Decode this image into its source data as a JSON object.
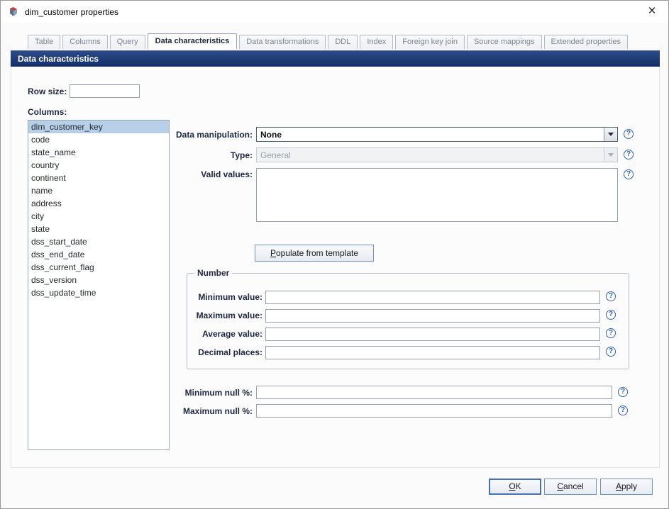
{
  "window": {
    "title": "dim_customer properties",
    "close_glyph": "×"
  },
  "tabs": {
    "items": [
      "Table",
      "Columns",
      "Query",
      "Data characteristics",
      "Data transformations",
      "DDL",
      "Index",
      "Foreign key join",
      "Source mappings",
      "Extended properties"
    ],
    "active": "Data characteristics"
  },
  "header": {
    "title": "Data characteristics"
  },
  "form": {
    "row_size": {
      "label": "Row size:",
      "value": ""
    },
    "columns": {
      "label": "Columns:",
      "items": [
        "dim_customer_key",
        "code",
        "state_name",
        "country",
        "continent",
        "name",
        "address",
        "city",
        "state",
        "dss_start_date",
        "dss_end_date",
        "dss_current_flag",
        "dss_version",
        "dss_update_time"
      ],
      "selected": "dim_customer_key"
    },
    "data_manipulation": {
      "label": "Data manipulation:",
      "value": "None"
    },
    "type": {
      "label": "Type:",
      "value": "General",
      "disabled": true
    },
    "valid_values": {
      "label": "Valid values:",
      "value": ""
    },
    "populate_button_label": "Populate from template",
    "number_group": {
      "title": "Number",
      "fields": [
        {
          "label": "Minimum value:",
          "value": ""
        },
        {
          "label": "Maximum value:",
          "value": ""
        },
        {
          "label": "Average value:",
          "value": ""
        },
        {
          "label": "Decimal places:",
          "value": ""
        }
      ]
    },
    "minimum_null": {
      "label": "Minimum null %:",
      "value": ""
    },
    "maximum_null": {
      "label": "Maximum null %:",
      "value": ""
    }
  },
  "footer": {
    "ok_label": "OK",
    "cancel_label": "Cancel",
    "apply_label": "Apply"
  },
  "icons": {
    "help": "?"
  },
  "colors": {
    "header_bg": "#1b3876",
    "selection_bg": "#b8cfe8",
    "help_blue": "#2f63b0",
    "label_color": "#1c2740"
  }
}
